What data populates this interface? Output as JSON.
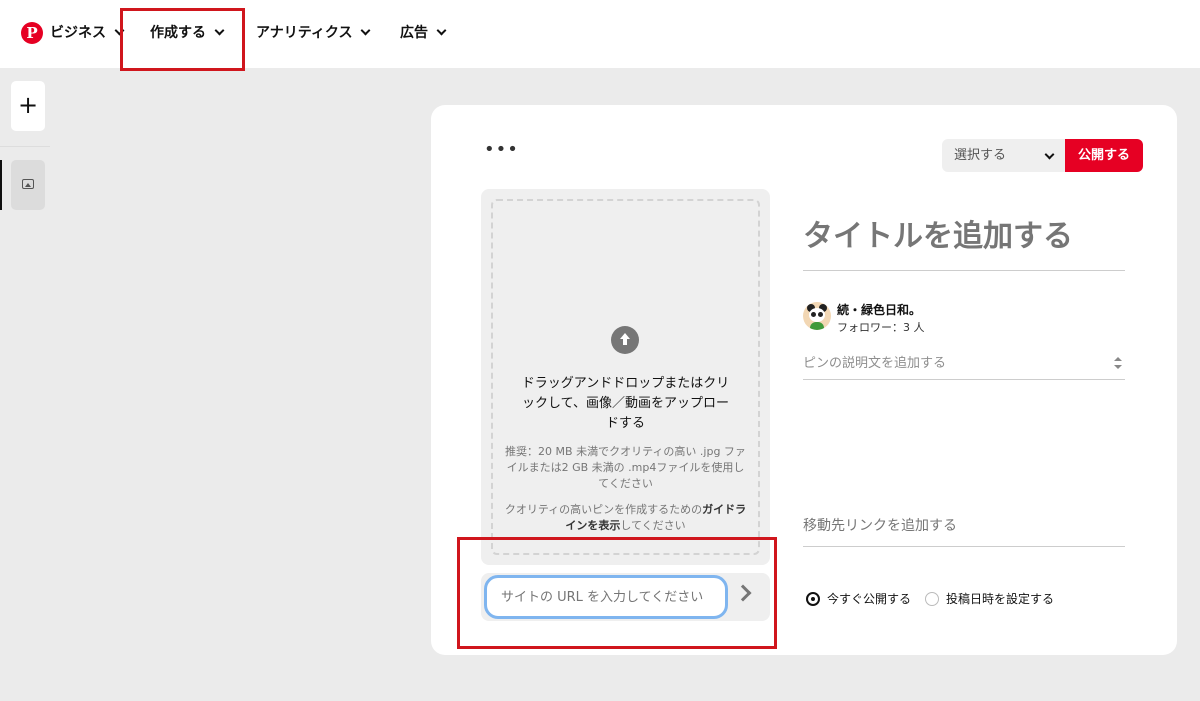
{
  "nav": {
    "logo_glyph": "P",
    "brand_label": "ビジネス",
    "items": [
      {
        "label": "作成する"
      },
      {
        "label": "アナリティクス"
      },
      {
        "label": "広告"
      }
    ]
  },
  "rail": {
    "add_glyph": "+"
  },
  "toolbar": {
    "more_glyph": "•••",
    "board_select": "選択する",
    "publish_label": "公開する"
  },
  "upload": {
    "main_text": "ドラッグアンドドロップまたはクリックして、画像／動画をアップロードする",
    "recommendation": "推奨：20 MB 未満でクオリティの高い .jpg ファイルまたは2 GB 未満の .mp4ファイルを使用してください",
    "guide_prefix": "クオリティの高いピンを作成するための",
    "guide_link": "ガイドラインを表示",
    "guide_suffix": "してください"
  },
  "url_input": {
    "placeholder": "サイトの URL を入力してください"
  },
  "form": {
    "title_placeholder": "タイトルを追加する",
    "account_name": "続・緑色日和。",
    "followers": "フォロワー：3 人",
    "description_placeholder": "ピンの説明文を追加する",
    "link_placeholder": "移動先リンクを追加する",
    "publish_options": [
      {
        "label": "今すぐ公開する",
        "selected": true
      },
      {
        "label": "投稿日時を設定する",
        "selected": false
      }
    ]
  },
  "colors": {
    "brand_red": "#e60023",
    "highlight_box": "#d0161d",
    "input_focus": "#7fb5ef"
  }
}
